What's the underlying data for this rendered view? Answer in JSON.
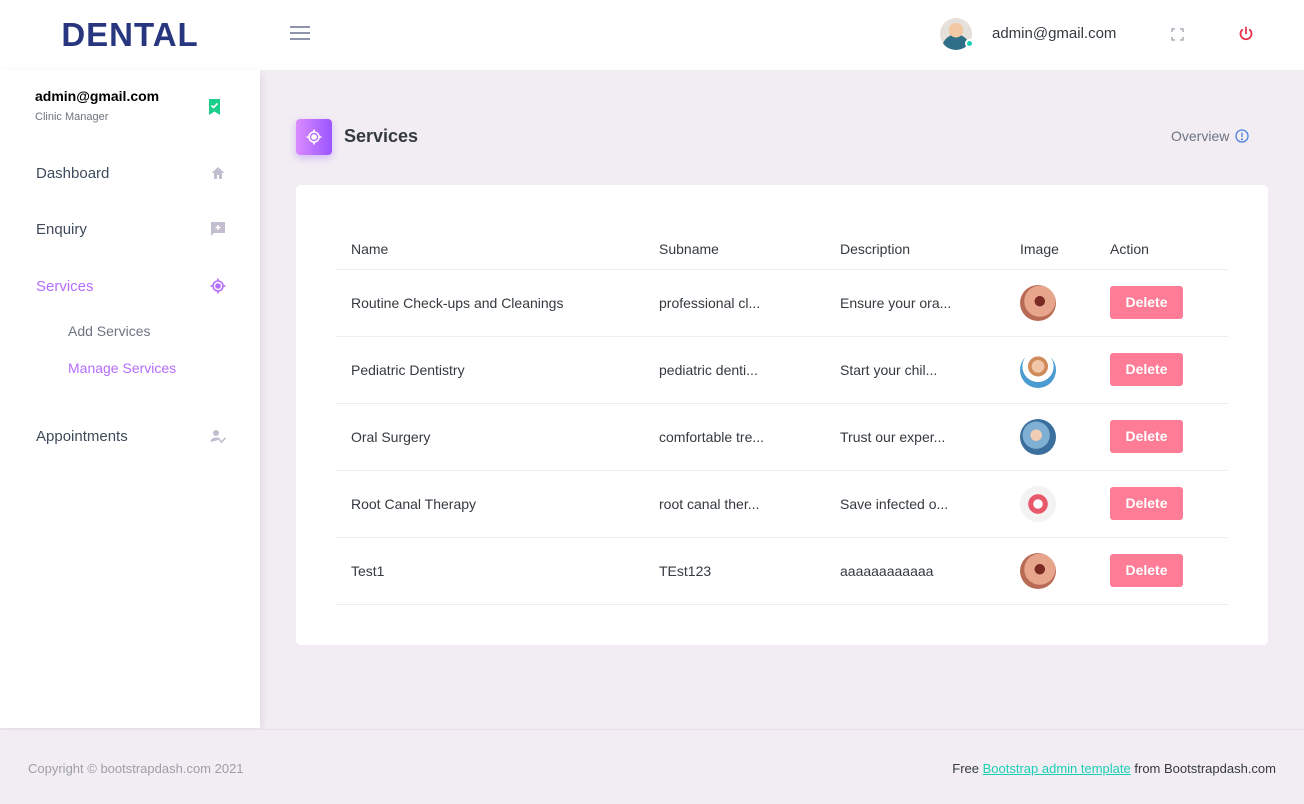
{
  "brand": "DENTAL",
  "header": {
    "user_email": "admin@gmail.com"
  },
  "sidebar": {
    "profile_name": "admin@gmail.com",
    "profile_role": "Clinic Manager",
    "items": [
      {
        "label": "Dashboard",
        "icon": "home-icon"
      },
      {
        "label": "Enquiry",
        "icon": "message-plus-icon"
      },
      {
        "label": "Services",
        "icon": "crosshairs-icon"
      },
      {
        "label": "Appointments",
        "icon": "account-check-icon"
      }
    ],
    "sub_items": [
      {
        "label": "Add Services"
      },
      {
        "label": "Manage Services"
      }
    ]
  },
  "page": {
    "title": "Services",
    "overview_label": "Overview"
  },
  "table": {
    "headers": [
      "Name",
      "Subname",
      "Description",
      "Image",
      "Action"
    ],
    "rows": [
      {
        "name": "Routine Check-ups and Cleanings",
        "subname": "professional cl...",
        "description": "Ensure your ora...",
        "action": "Delete"
      },
      {
        "name": "Pediatric Dentistry",
        "subname": "pediatric denti...",
        "description": "Start your chil...",
        "action": "Delete"
      },
      {
        "name": "Oral Surgery",
        "subname": "comfortable tre...",
        "description": "Trust our exper...",
        "action": "Delete"
      },
      {
        "name": "Root Canal Therapy",
        "subname": "root canal ther...",
        "description": "Save infected o...",
        "action": "Delete"
      },
      {
        "name": "Test1",
        "subname": "TEst123",
        "description": "aaaaaaaaaaaa",
        "action": "Delete"
      }
    ]
  },
  "footer": {
    "copyright": "Copyright © bootstrapdash.com 2021",
    "free_prefix": "Free",
    "link_text": "Bootstrap admin template",
    "suffix": "from Bootstrapdash.com"
  },
  "colors": {
    "accent": "#b66dff",
    "brand": "#27367f",
    "delete": "#fe7c96",
    "link": "#1bcfb4",
    "power": "#fe7c96"
  }
}
